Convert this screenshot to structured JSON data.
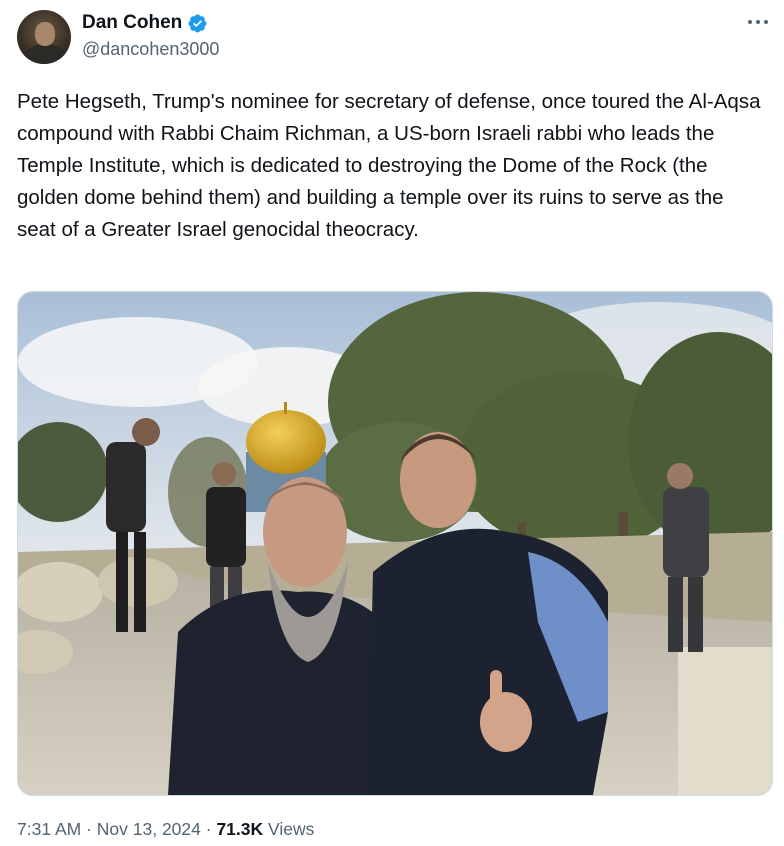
{
  "author": {
    "display_name": "Dan Cohen",
    "handle": "@dancohen3000",
    "verified_icon": "verified-badge-icon",
    "verified_color": "#1d9bf0"
  },
  "menu": {
    "icon": "more-horizontal-icon"
  },
  "tweet": {
    "text": "Pete Hegseth, Trump's nominee for secretary of defense, once toured the Al-Aqsa compound with Rabbi Chaim Richman, a US-born Israeli rabbi who leads the Temple Institute, which is dedicated to destroying the Dome of the Rock (the golden dome behind them) and building a temple over its ruins to serve as the seat of a Greater Israel genocidal theocracy."
  },
  "media": {
    "type": "photo"
  },
  "meta": {
    "time": "7:31 AM",
    "sep1": " · ",
    "date": "Nov 13, 2024",
    "sep2": " · ",
    "views_count": "71.3K",
    "views_label": " Views"
  },
  "colors": {
    "text_primary": "#0f1419",
    "text_secondary": "#536471",
    "border": "#cfd9de"
  }
}
